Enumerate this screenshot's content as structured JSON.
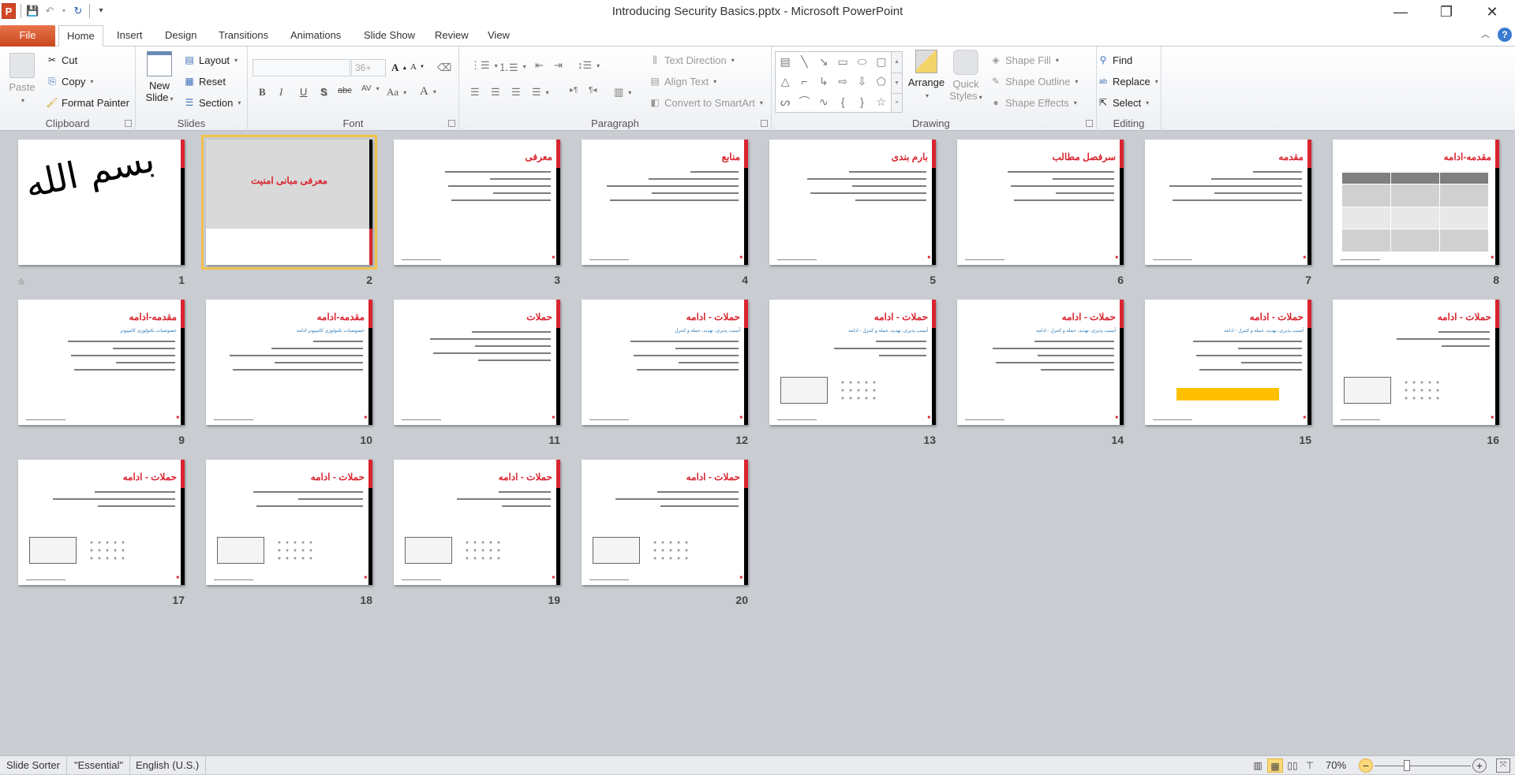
{
  "window": {
    "title": "Introducing Security Basics.pptx  -  Microsoft PowerPoint",
    "app_icon": "P",
    "controls": {
      "minimize": "—",
      "restore": "❐",
      "close": "✕"
    }
  },
  "tabs": [
    {
      "label": "File"
    },
    {
      "label": "Home",
      "active": true
    },
    {
      "label": "Insert"
    },
    {
      "label": "Design"
    },
    {
      "label": "Transitions"
    },
    {
      "label": "Animations"
    },
    {
      "label": "Slide Show"
    },
    {
      "label": "Review"
    },
    {
      "label": "View"
    }
  ],
  "ribbon": {
    "clipboard": {
      "label": "Clipboard",
      "paste": "Paste",
      "cut": "Cut",
      "copy": "Copy",
      "format_painter": "Format Painter"
    },
    "slides": {
      "label": "Slides",
      "new_slide_1": "New",
      "new_slide_2": "Slide",
      "layout": "Layout",
      "reset": "Reset",
      "section": "Section"
    },
    "font": {
      "label": "Font",
      "font_name": "",
      "font_size": "36+"
    },
    "paragraph": {
      "label": "Paragraph",
      "text_direction": "Text Direction",
      "align_text": "Align Text",
      "convert_smartart": "Convert to SmartArt"
    },
    "drawing": {
      "label": "Drawing",
      "arrange": "Arrange",
      "quick_styles_1": "Quick",
      "quick_styles_2": "Styles",
      "shape_fill": "Shape Fill",
      "shape_outline": "Shape Outline",
      "shape_effects": "Shape Effects"
    },
    "editing": {
      "label": "Editing",
      "find": "Find",
      "replace": "Replace",
      "select": "Select"
    }
  },
  "slides": [
    {
      "number": "1",
      "title": "",
      "type": "calligraphy"
    },
    {
      "number": "2",
      "title": "معرفی مبانی امنیت",
      "type": "title",
      "selected": true
    },
    {
      "number": "3",
      "title": "معرفی",
      "type": "bullets"
    },
    {
      "number": "4",
      "title": "منابع",
      "type": "bullets"
    },
    {
      "number": "5",
      "title": "بارم بندی",
      "type": "bullets"
    },
    {
      "number": "6",
      "title": "سرفصل مطالب",
      "type": "bullets"
    },
    {
      "number": "7",
      "title": "مقدمه",
      "type": "bullets"
    },
    {
      "number": "8",
      "title": "مقدمه-ادامه",
      "type": "table"
    },
    {
      "number": "9",
      "title": "مقدمه-ادامه",
      "subtitle": "خصوصیات تکنولوژی کامپیوتر",
      "type": "bullets"
    },
    {
      "number": "10",
      "title": "مقدمه-ادامه",
      "subtitle": "خصوصیات تکنولوژی کامپیوتر-ادامه",
      "type": "bullets"
    },
    {
      "number": "11",
      "title": "حملات",
      "type": "bullets"
    },
    {
      "number": "12",
      "title": "حملات - ادامه",
      "subtitle": "آسیب پذیری، تهدید، حمله و کنترل",
      "type": "bullets"
    },
    {
      "number": "13",
      "title": "حملات - ادامه",
      "subtitle": "آسیب پذیری، تهدید، حمله و کنترل - ادامه",
      "type": "figure"
    },
    {
      "number": "14",
      "title": "حملات - ادامه",
      "subtitle": "آسیب پذیری، تهدید، حمله و کنترل - ادامه",
      "type": "bullets"
    },
    {
      "number": "15",
      "title": "حملات - ادامه",
      "subtitle": "آسیب پذیری، تهدید، حمله و کنترل - ادامه",
      "type": "highlight"
    },
    {
      "number": "16",
      "title": "حملات - ادامه",
      "type": "figure"
    },
    {
      "number": "17",
      "title": "حملات - ادامه",
      "type": "figure"
    },
    {
      "number": "18",
      "title": "حملات - ادامه",
      "type": "figure"
    },
    {
      "number": "19",
      "title": "حملات - ادامه",
      "type": "figure"
    },
    {
      "number": "20",
      "title": "حملات - ادامه",
      "type": "figure"
    }
  ],
  "statusbar": {
    "view": "Slide Sorter",
    "theme": "\"Essential\"",
    "language": "English (U.S.)",
    "zoom": "70%",
    "zoom_fraction": 0.7
  }
}
